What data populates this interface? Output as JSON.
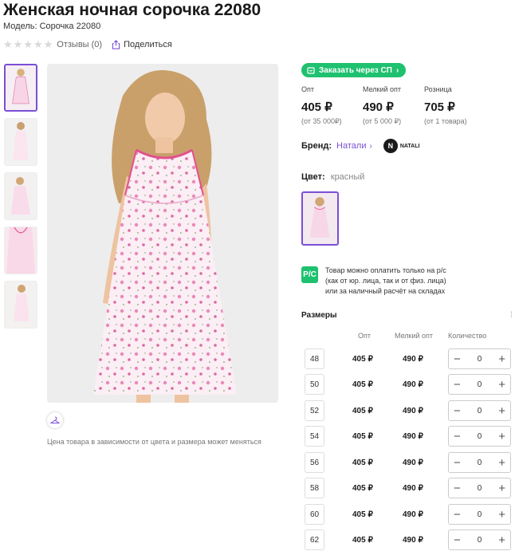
{
  "product": {
    "title": "Женская ночная сорочка 22080",
    "model": "Модель: Сорочка 22080",
    "reviews": "Отзывы (0)",
    "share": "Поделиться"
  },
  "gallery": {
    "thumbnail_count": 5,
    "price_note": "Цена товара в зависимости от цвета и размера может меняться"
  },
  "order_button": "Заказать через СП",
  "prices": [
    {
      "label": "Опт",
      "value": "405 ₽",
      "note": "(от 35 000₽)"
    },
    {
      "label": "Мелкий опт",
      "value": "490 ₽",
      "note": "(от 5 000 ₽)"
    },
    {
      "label": "Розница",
      "value": "705 ₽",
      "note": "(от 1 товара)"
    }
  ],
  "brand": {
    "label": "Бренд:",
    "name": "Натали",
    "logo_text": "NATALI",
    "logo_letter": "N"
  },
  "color": {
    "label": "Цвет:",
    "value": "красный"
  },
  "payment": {
    "icon_text": "Р/С",
    "line1": "Товар можно оплатить только на р/с",
    "line2": "(как от юр. лица, так и от физ. лица)",
    "line3": "или за наличный расчёт на складах"
  },
  "sizes": {
    "title": "Размеры",
    "headers": {
      "opt": "Опт",
      "small_opt": "Мелкий опт",
      "qty": "Количество"
    },
    "rows": [
      {
        "size": "48",
        "opt": "405 ₽",
        "small_opt": "490 ₽",
        "qty": "0"
      },
      {
        "size": "50",
        "opt": "405 ₽",
        "small_opt": "490 ₽",
        "qty": "0"
      },
      {
        "size": "52",
        "opt": "405 ₽",
        "small_opt": "490 ₽",
        "qty": "0"
      },
      {
        "size": "54",
        "opt": "405 ₽",
        "small_opt": "490 ₽",
        "qty": "0"
      },
      {
        "size": "56",
        "opt": "405 ₽",
        "small_opt": "490 ₽",
        "qty": "0"
      },
      {
        "size": "58",
        "opt": "405 ₽",
        "small_opt": "490 ₽",
        "qty": "0"
      },
      {
        "size": "60",
        "opt": "405 ₽",
        "small_opt": "490 ₽",
        "qty": "0"
      },
      {
        "size": "62",
        "opt": "405 ₽",
        "small_opt": "490 ₽",
        "qty": "0"
      }
    ]
  },
  "colors": {
    "accent": "#7b4fd6",
    "green": "#1ec16f"
  }
}
